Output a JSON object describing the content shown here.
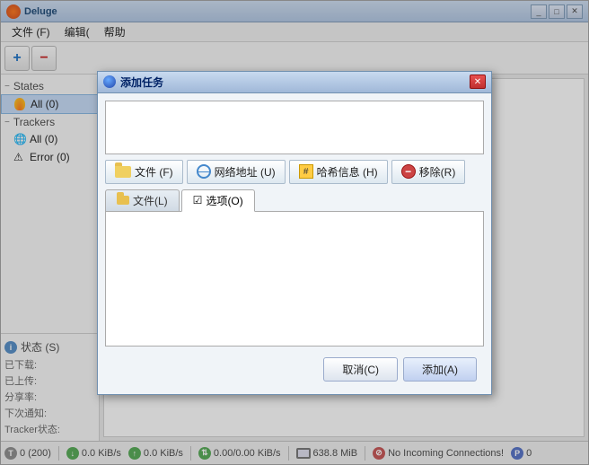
{
  "window": {
    "title": "Deluge",
    "title_icon": "flame"
  },
  "menu": {
    "items": [
      {
        "label": "文件 (F)"
      },
      {
        "label": "编辑("
      },
      {
        "label": "帮助"
      }
    ]
  },
  "toolbar": {
    "add_label": "+",
    "remove_label": "−"
  },
  "sidebar": {
    "states_label": "States",
    "states_dash": "−",
    "trackers_label": "Trackers",
    "trackers_dash": "−",
    "all_states": "All (0)",
    "all_trackers": "All (0)",
    "error_label": "Error (0)",
    "status_header": "状态 (S)",
    "download_label": "已下载:",
    "upload_label": "已上传:",
    "share_label": "分享率:",
    "next_notify": "下次通知:",
    "tracker_state": "Tracker状态:"
  },
  "dialog": {
    "title": "添加任务",
    "btn_file": "文件 (F)",
    "btn_web": "网络地址 (U)",
    "btn_hash": "哈希信息 (H)",
    "btn_remove": "移除(R)",
    "tab_file": "文件(L)",
    "tab_options": "选项(O)",
    "cancel_label": "取消(C)",
    "add_label": "添加(A)"
  },
  "statusbar": {
    "torrent_count": "0 (200)",
    "download_speed": "0.0 KiB/s",
    "upload_speed": "0.0 KiB/s",
    "transfer_speed": "0.00/0.00 KiB/s",
    "disk_space": "638.8 MiB",
    "connection_status": "No Incoming Connections!",
    "peer_count": "0"
  }
}
